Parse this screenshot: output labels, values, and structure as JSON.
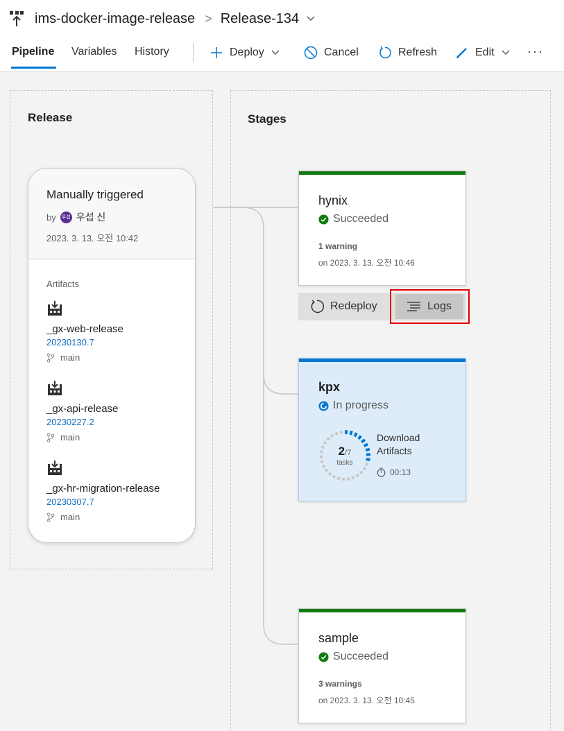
{
  "header": {
    "pipeline_name": "ims-docker-image-release",
    "separator": ">",
    "release_name": "Release-134"
  },
  "tabs": [
    {
      "label": "Pipeline",
      "active": true
    },
    {
      "label": "Variables",
      "active": false
    },
    {
      "label": "History",
      "active": false
    }
  ],
  "toolbar": {
    "deploy": "Deploy",
    "cancel": "Cancel",
    "refresh": "Refresh",
    "edit": "Edit",
    "more": "···"
  },
  "release_panel": {
    "title": "Release",
    "trigger": "Manually triggered",
    "by_label": "by",
    "avatar_text": "우섭",
    "user": "우섭 신",
    "date": "2023. 3. 13. 오전 10:42",
    "artifacts_label": "Artifacts",
    "artifacts": [
      {
        "name": "_gx-web-release",
        "version": "20230130.7",
        "branch": "main"
      },
      {
        "name": "_gx-api-release",
        "version": "20230227.2",
        "branch": "main"
      },
      {
        "name": "_gx-hr-migration-release",
        "version": "20230307.7",
        "branch": "main"
      }
    ]
  },
  "stages_panel": {
    "title": "Stages",
    "stages": [
      {
        "name": "hynix",
        "status": "Succeeded",
        "warnings": "1 warning",
        "date": "on 2023. 3. 13. 오전 10:46"
      },
      {
        "name": "kpx",
        "status": "In progress",
        "progress_done": "2",
        "progress_total": "/7",
        "progress_unit": "tasks",
        "progress_fraction": 0.2857,
        "task": "Download Artifacts",
        "elapsed": "00:13"
      },
      {
        "name": "sample",
        "status": "Succeeded",
        "warnings": "3 warnings",
        "date": "on 2023. 3. 13. 오전 10:45"
      }
    ],
    "redeploy": "Redeploy",
    "logs": "Logs"
  },
  "colors": {
    "accent": "#0078d4",
    "success": "#107c10",
    "in_progress": "#0078d4",
    "highlight_box": "#e00000",
    "link": "#106ebe"
  }
}
